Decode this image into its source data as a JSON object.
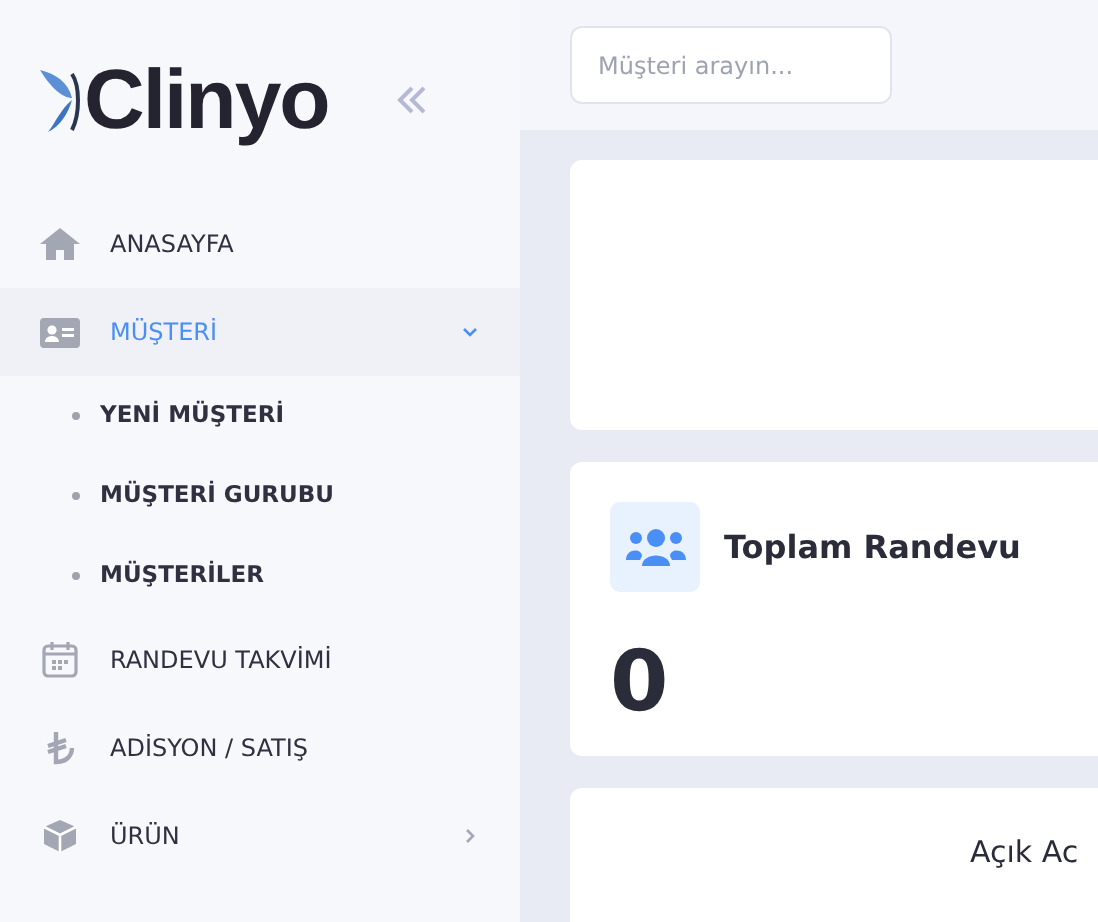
{
  "sidebar": {
    "logo": "Clinyo",
    "menu": [
      {
        "label": "ANASAYFA",
        "selected": false
      },
      {
        "label": "MÜŞTERİ",
        "selected": true,
        "expanded": true,
        "children": [
          {
            "label": "YENİ MÜŞTERİ"
          },
          {
            "label": "MÜŞTERİ GURUBU"
          },
          {
            "label": "MÜŞTERİLER"
          }
        ]
      },
      {
        "label": "RANDEVU TAKVİMİ",
        "selected": false
      },
      {
        "label": "ADİSYON / SATIŞ",
        "selected": false
      },
      {
        "label": "ÜRÜN",
        "selected": false,
        "expanded": false
      }
    ]
  },
  "header": {
    "search": {
      "placeholder": "Müşteri arayın..."
    }
  },
  "stat_card": {
    "title": "Toplam Randevu",
    "value": "0"
  },
  "panel": {
    "title": "Açık Ac"
  }
}
